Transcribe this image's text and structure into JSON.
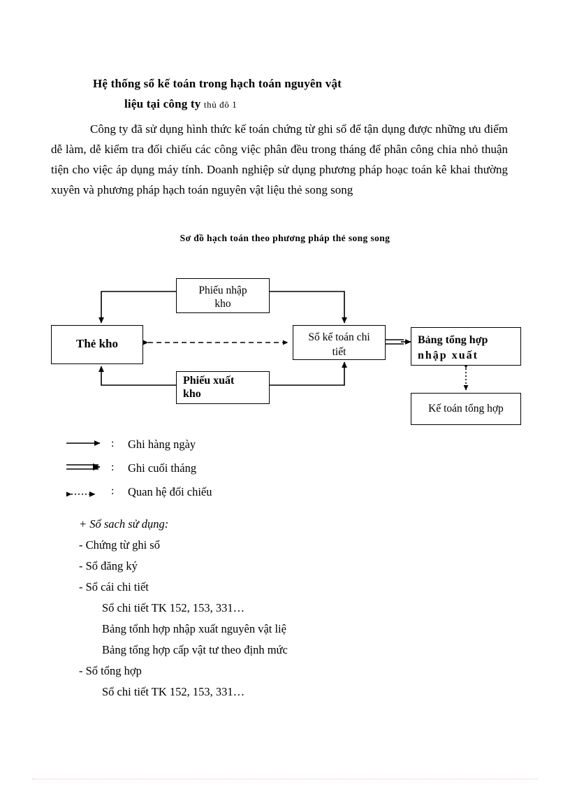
{
  "document": {
    "title_line_1": "Hệ thống sổ kế toán trong hạch toán nguyên vật",
    "title_line_2": "liệu tại công ty",
    "title_line_2_suffix": "thủ đô 1",
    "paragraph": "Công ty đã sử dụng hình thức kế toán chứng từ ghi sổ để tận dụng được những ưu điểm dễ làm, dễ kiểm tra đối chiếu các công việc phân đều trong tháng để phân công chia nhỏ thuận tiện cho việc áp dụng máy tính. Doanh nghiệp sử dụng phương pháp hoạc toán kê khai thường xuyên và phương pháp hạch toán nguyên vật liệu thẻ song song"
  },
  "diagram": {
    "caption": "Sơ đồ hạch toán theo phương pháp thẻ song song",
    "nodes": {
      "phieu_nhap_kho": {
        "line1": "Phiếu nhập",
        "line2": "kho"
      },
      "the_kho": {
        "line1": "Thẻ kho"
      },
      "so_ke_toan_chi_tiet": {
        "line1": "Sổ kế toán chi",
        "line2": "tiết"
      },
      "bang_tong_hop_nhap_xuat": {
        "line1": "Bảng tổng hợp",
        "line2": "nhập    xuất"
      },
      "phieu_xuat_kho": {
        "line1": "Phiếu xuất",
        "line2": "kho"
      },
      "ke_toan_tong_hop": {
        "line1": "Kế toán tổng hợp"
      }
    },
    "line_color": "#000000"
  },
  "legend": {
    "items": [
      {
        "mark": "solid-arrow-right-icon",
        "colon": ":",
        "label": "Ghi hàng ngày"
      },
      {
        "mark": "double-arrow-right-icon",
        "colon": ":",
        "label": "Ghi cuối tháng"
      },
      {
        "mark": "dotted-double-headed-arrow-icon",
        "colon": ":",
        "label": "Quan hệ đối chiếu"
      }
    ]
  },
  "book_list": {
    "heading": "+ Sổ sach sử dụng:",
    "items": [
      {
        "text": "- Chứng từ ghi sổ",
        "indent": false
      },
      {
        "text": "- Sổ đăng ký",
        "indent": false
      },
      {
        "text": "- Sổ cái chi tiết",
        "indent": false
      },
      {
        "text": "Sổ chi tiết TK 152, 153, 331…",
        "indent": true
      },
      {
        "text": "Bảng tổnh hợp nhập xuất nguyên vật liệ",
        "indent": true
      },
      {
        "text": "Bảng tổng hợp cấp vật tư theo định mức",
        "indent": true
      },
      {
        "text": "- Sổ tổng hợp",
        "indent": false
      },
      {
        "text": "Sổ chi tiết TK 152, 153, 331…",
        "indent": true
      }
    ]
  }
}
